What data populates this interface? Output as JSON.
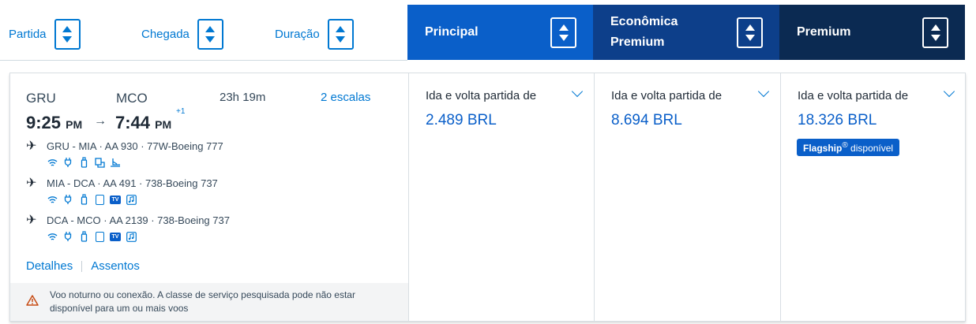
{
  "sort": {
    "departure": "Partida",
    "arrival": "Chegada",
    "duration": "Duração"
  },
  "cabins": {
    "main": "Principal",
    "economy_premium_line1": "Econômica",
    "economy_premium_line2": "Premium",
    "premium": "Premium"
  },
  "flight": {
    "origin": "GRU",
    "destination": "MCO",
    "depart_time": "9:25",
    "depart_period": "PM",
    "arrive_time": "7:44",
    "arrive_period": "PM",
    "day_offset": "+1",
    "duration": "23h 19m",
    "stops": "2 escalas",
    "segments": [
      {
        "text": "GRU - MIA · AA 930 · 77W-Boeing 777",
        "amenities": [
          "wifi-icon",
          "power-icon",
          "usb-icon",
          "seatback-icon",
          "lie-flat-icon"
        ]
      },
      {
        "text": "MIA - DCA · AA 491 · 738-Boeing 737",
        "amenities": [
          "wifi-icon",
          "power-icon",
          "usb-icon",
          "device-icon",
          "tv-icon",
          "music-icon"
        ]
      },
      {
        "text": "DCA - MCO · AA 2139 · 738-Boeing 737",
        "amenities": [
          "wifi-icon",
          "power-icon",
          "usb-icon",
          "device-icon",
          "tv-icon",
          "music-icon"
        ]
      }
    ],
    "details_link": "Detalhes",
    "seats_link": "Assentos",
    "warning": "Voo noturno ou conexão. A classe de serviço pesquisada pode não estar disponível para um ou mais voos"
  },
  "fares": {
    "label": "Ida e volta partida de",
    "main_price": "2.489 BRL",
    "economy_premium_price": "8.694 BRL",
    "premium_price": "18.326 BRL",
    "flagship_brand": "Flagship",
    "flagship_reg": "®",
    "flagship_text": " disponível"
  },
  "colors": {
    "accent": "#0078d2",
    "main_header": "#0a5fc9",
    "economy_premium_header": "#0d3f8a",
    "premium_header": "#0b2a52",
    "warning_icon": "#c74b13"
  }
}
